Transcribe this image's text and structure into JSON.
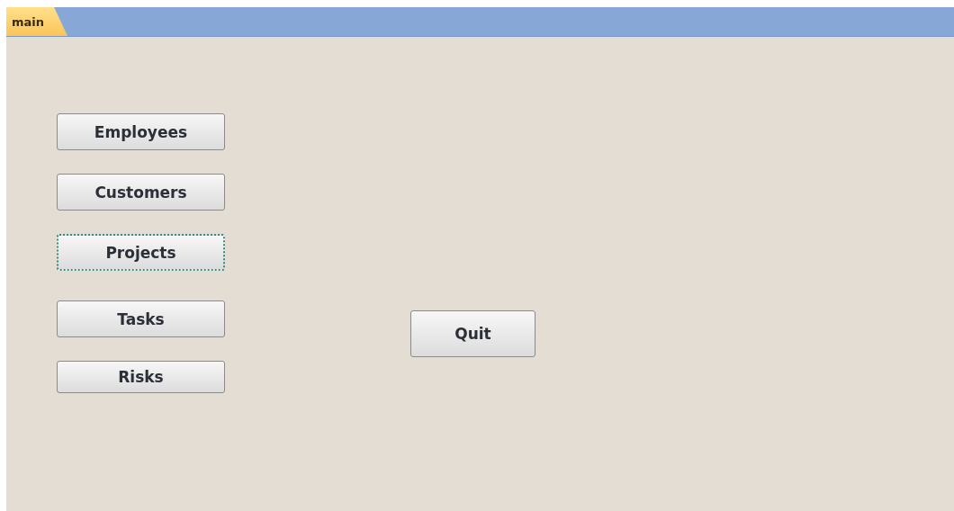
{
  "tabs": [
    {
      "label": "main",
      "selected": true
    }
  ],
  "menu_buttons": [
    {
      "label": "Employees",
      "focused": false
    },
    {
      "label": "Customers",
      "focused": false
    },
    {
      "label": "Projects",
      "focused": true
    },
    {
      "label": "Tasks",
      "focused": false
    },
    {
      "label": "Risks",
      "focused": false
    }
  ],
  "quit_button": {
    "label": "Quit"
  }
}
